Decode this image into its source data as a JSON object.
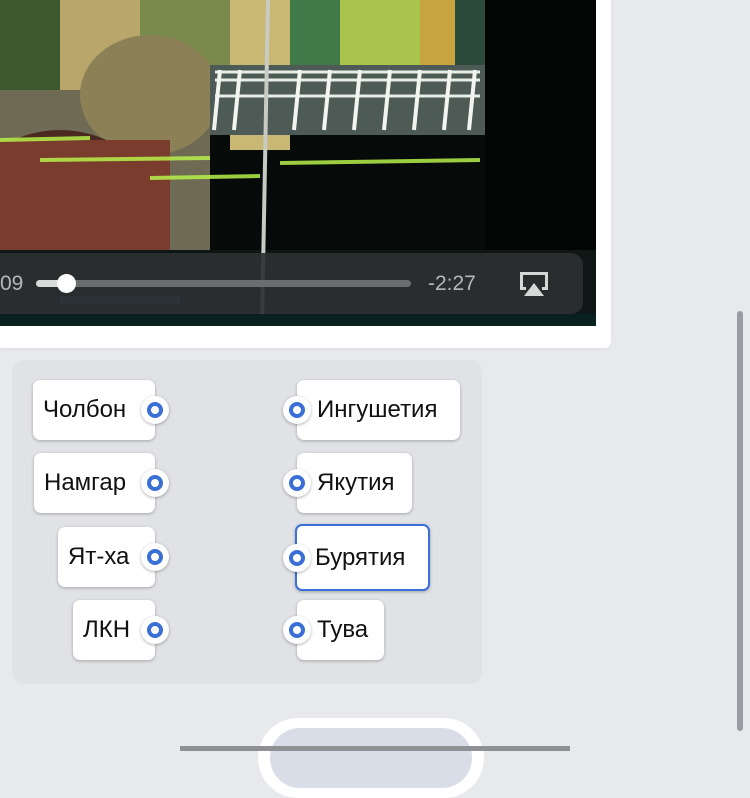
{
  "video": {
    "time_elapsed": "09",
    "time_remaining": "-2:27",
    "progress_fraction": 0.08
  },
  "matching": {
    "left_items": [
      {
        "label": "Чолбон"
      },
      {
        "label": "Намгар"
      },
      {
        "label": "Ят-ха"
      },
      {
        "label": "ЛКН"
      }
    ],
    "right_items": [
      {
        "label": "Ингушетия",
        "selected": false
      },
      {
        "label": "Якутия",
        "selected": false
      },
      {
        "label": "Бурятия",
        "selected": true
      },
      {
        "label": "Тува",
        "selected": false
      }
    ]
  },
  "colors": {
    "accent": "#3a6fd6",
    "page_background": "#e8e9ed",
    "panel_background": "#e1e2e6"
  },
  "icons": {
    "airplay": "airplay-icon"
  }
}
